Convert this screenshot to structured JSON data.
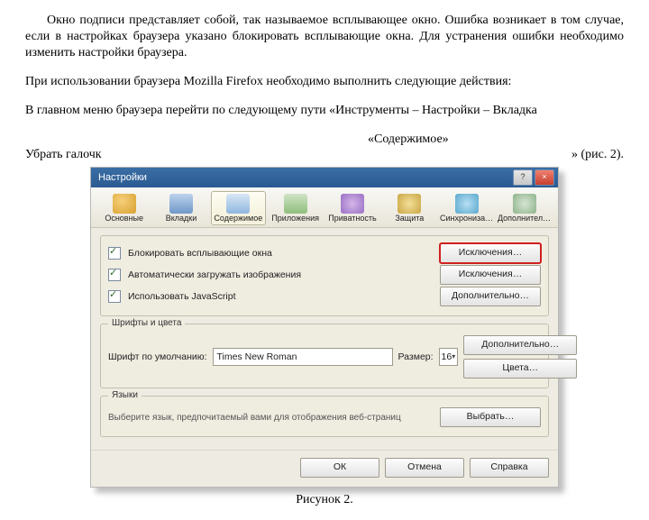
{
  "doc": {
    "para1": "Окно подписи представляет собой, так называемое всплывающее окно. Ошибка возникает в том случае, если в настройках браузера указано блокировать всплывающие окна. Для устранения ошибки необходимо изменить настройки браузера.",
    "para2": "При использовании браузера Mozilla Firefox необходимо выполнить следующие действия:",
    "para3": "В главном меню браузера перейти по следующему пути «Инструменты – Настройки – Вкладка",
    "para3_right": "«Содержимое»",
    "para4_left": "Убрать   галочк",
    "para4_right": "»   (рис.   2).",
    "caption": "Рисунок 2."
  },
  "win": {
    "title": "Настройки",
    "cats": [
      "Основные",
      "Вкладки",
      "Содержимое",
      "Приложения",
      "Приватность",
      "Защита",
      "Синхронизация",
      "Дополнительные"
    ],
    "chk1": "Блокировать всплывающие окна",
    "chk2": "Автоматически загружать изображения",
    "chk3": "Использовать JavaScript",
    "excBtn": "Исключения…",
    "advBtn": "Дополнительно…",
    "fontsLegend": "Шрифты и цвета",
    "fontLabel": "Шрифт по умолчанию:",
    "fontValue": "Times New Roman",
    "sizeLabel": "Размер:",
    "sizeValue": "16",
    "extraBtn": "Дополнительно…",
    "colorsBtn": "Цвета…",
    "langLegend": "Языки",
    "langHint": "Выберите язык, предпочитаемый вами для отображения веб-страниц",
    "chooseBtn": "Выбрать…",
    "ok": "ОК",
    "cancel": "Отмена",
    "help": "Справка"
  }
}
